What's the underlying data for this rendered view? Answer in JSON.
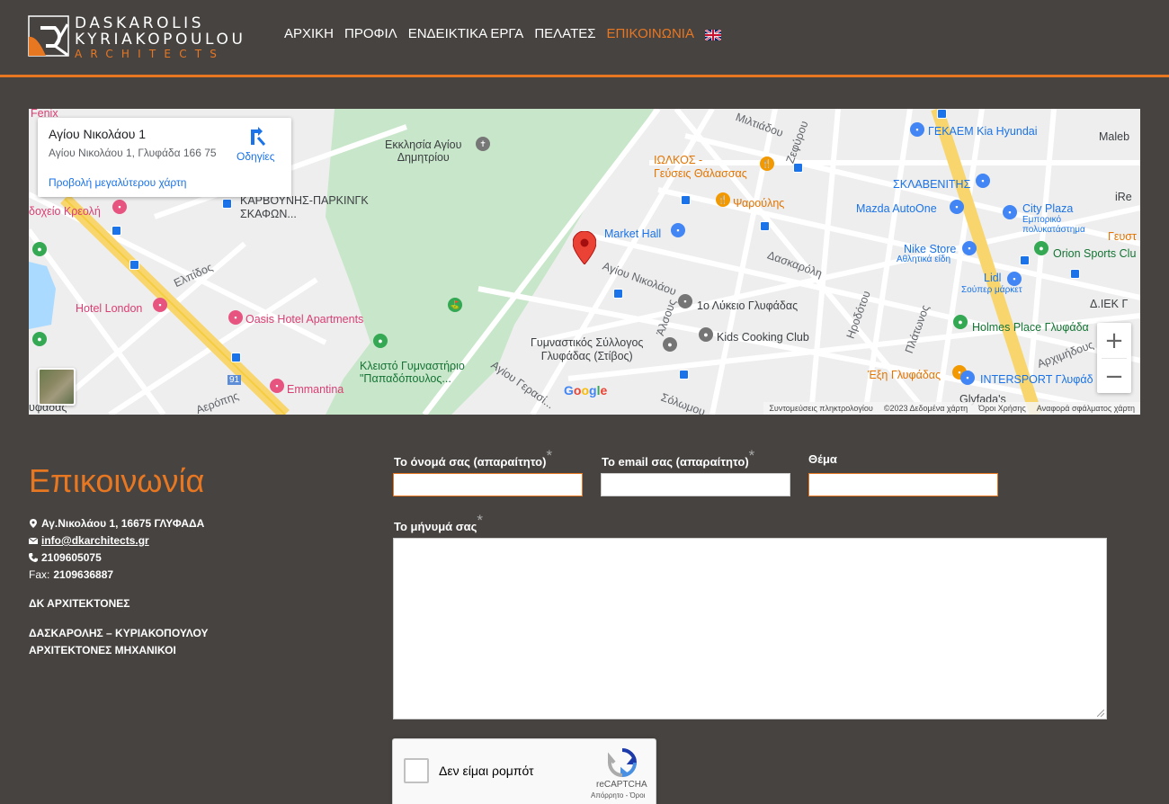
{
  "brand": {
    "line1": "DASKAROLIS",
    "line2": "KYRIAKOPOULOU",
    "line3": "ARCHITECTS",
    "accent": "#e87722",
    "background": "#474341"
  },
  "nav": {
    "items": [
      {
        "label": "ΑΡΧΙΚΗ",
        "active": false
      },
      {
        "label": "ΠΡΟΦΙΛ",
        "active": false
      },
      {
        "label": "ΕΝΔΕΙΚΤΙΚΑ ΕΡΓΑ",
        "active": false
      },
      {
        "label": "ΠΕΛΑΤΕΣ",
        "active": false
      },
      {
        "label": "ΕΠΙΚΟΙΝΩΝΙΑ",
        "active": true
      }
    ],
    "language_icon": "uk-flag-icon"
  },
  "map": {
    "card": {
      "title": "Αγίου Νικολάου 1",
      "address": "Αγίου Νικολάου 1, Γλυφάδα 166 75",
      "directions": "Οδηγίες",
      "larger_map": "Προβολή μεγαλύτερου χάρτη"
    },
    "labels": {
      "church": "Εκκλησία Αγίου\nΔημητρίου",
      "parking": "ΚΑΡΒΟΥΝΗΣ-ΠΑΡΚΙΝΓΚ\nΣΚΑΦΩΝ...",
      "fenix": "Fenix",
      "kreoli": "δοχείο Κρεολή",
      "hotel_london": "Hotel London",
      "oasis": "Oasis Hotel Apartments",
      "elpidos": "Ελπίδος",
      "gym": "Κλειστό Γυμναστήριο\n\"Παπαδόπουλος...",
      "emmantina": "Emmantina",
      "agiou_gerasimou": "Αγίου Γερασί...",
      "ludo": "υφάδας",
      "miltiadou": "Μιλτιάδου",
      "zefirou": "Ζεφύρου",
      "idalos": "ΙΩΛΚΟΣ -\nΓεύσεις Θάλασσας",
      "farouli": "Ψαρούλης",
      "market_hall": "Market Hall",
      "agiou_nikolaou": "Αγίου Νικολάου",
      "lykeio": "1ο Λύκειο Γλυφάδας",
      "gymnastikos": "Γυμναστικός Σύλλογος\nΓλυφάδας (Στίβος)",
      "kids_cooking": "Kids Cooking Club",
      "alsous": "Άλσους",
      "daskaroli": "Δασκαρόλη",
      "irodotou": "Ηροδότου",
      "platonos": "Πλάτωνος",
      "solomou": "Σόλωμου",
      "gekaem": "ΓΕΚΑΕΜ Kia Hyundai",
      "sklavenitis": "ΣΚΛΑΒΕΝΙΤΗΣ",
      "mazda": "Mazda AutoOne",
      "city_plaza": "City Plaza",
      "city_plaza_sub": "Εμπορικό\nπολυκατάστημα",
      "nike": "Nike Store",
      "nike_sub": "Αθλητικά είδη",
      "orion": "Orion Sports Clu",
      "lidl": "Lidl",
      "lidl_sub": "Σούπερ μάρκετ",
      "holmes": "Holmes Place Γλυφάδα",
      "iek": "Δ.ΙΕΚ Γ",
      "exi": "Έξη Γλυφάδας",
      "intersport": "INTERSPORT Γλυφάδ",
      "glyfadas": "Glyfada's",
      "archimidous": "Αρχιμήδους",
      "maleb": "Maleb",
      "ire": "iRe",
      "geusi": "Γευστ",
      "road91": "91",
      "geropis": "Αερόπης"
    },
    "google": "Google",
    "attribution": [
      "Συντομεύσεις πληκτρολογίου",
      "©2023 Δεδομένα χάρτη",
      "Όροι Χρήσης",
      "Αναφορά σφάλματος χάρτη"
    ],
    "zoom_in": "+",
    "zoom_out": "−"
  },
  "contact": {
    "title": "Επικοινωνία",
    "address": "Αγ.Νικολάου 1, 16675 ΓΛΥΦΑΔΑ",
    "email": "info@dkarchitects.gr",
    "phone": "2109605075",
    "fax_label": "Fax:",
    "fax": "2109636887",
    "company": "ΔΚ ΑΡΧΙΤΕΚΤΟΝΕΣ",
    "company_full_1": "ΔΑΣΚΑΡΟΛΗΣ – ΚΥΡΙΑΚΟΠΟΥΛΟΥ",
    "company_full_2": "ΑΡΧΙΤΕΚΤΟΝΕΣ ΜΗΧΑΝΙΚΟΙ"
  },
  "form": {
    "name_label": "Το όνομά σας (απαραίτητο)",
    "email_label": "Το email σας (απαραίτητο)",
    "subject_label": "Θέμα",
    "message_label": "Το μήνυμά σας",
    "required_mark": "*",
    "name_value": "",
    "email_value": "",
    "subject_value": "",
    "message_value": ""
  },
  "recaptcha": {
    "label": "Δεν είμαι ρομπότ",
    "brand": "reCAPTCHA",
    "terms": "Απόρρητο - Όροι"
  }
}
